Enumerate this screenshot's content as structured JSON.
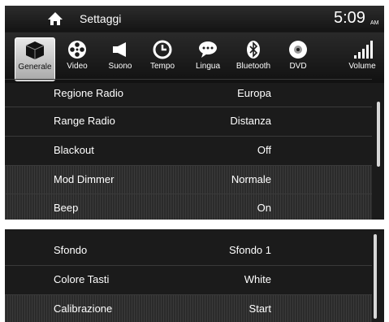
{
  "status": {
    "title": "Settaggi",
    "time": "5:09",
    "ampm": "AM"
  },
  "tabs": [
    {
      "label": "Generale",
      "icon": "cube-icon",
      "active": true
    },
    {
      "label": "Video",
      "icon": "film-reel-icon"
    },
    {
      "label": "Suono",
      "icon": "speaker-icon"
    },
    {
      "label": "Tempo",
      "icon": "clock-icon"
    },
    {
      "label": "Lingua",
      "icon": "speech-bubble-icon"
    },
    {
      "label": "Bluetooth",
      "icon": "bluetooth-icon"
    },
    {
      "label": "DVD",
      "icon": "disc-icon"
    },
    {
      "label": "Volume",
      "icon": "volume-bars-icon"
    }
  ],
  "list1": [
    {
      "label": "Regione Radio",
      "value": "Europa"
    },
    {
      "label": "Range Radio",
      "value": "Distanza"
    },
    {
      "label": "Blackout",
      "value": "Off"
    },
    {
      "label": "Mod Dimmer",
      "value": "Normale"
    },
    {
      "label": "Beep",
      "value": "On"
    }
  ],
  "list2": [
    {
      "label": "Sfondo",
      "value": "Sfondo 1"
    },
    {
      "label": "Colore Tasti",
      "value": "White"
    },
    {
      "label": "Calibrazione",
      "value": "Start"
    }
  ]
}
